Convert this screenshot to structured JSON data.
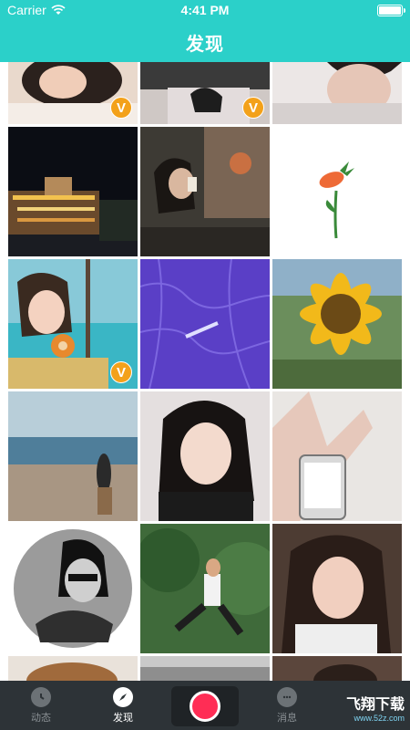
{
  "status_bar": {
    "carrier": "Carrier",
    "time": "4:41 PM"
  },
  "header": {
    "title": "发现"
  },
  "grid": {
    "badge_label": "V",
    "tiles": [
      {
        "name": "photo-girl-lying",
        "badge": true
      },
      {
        "name": "photo-hands-table",
        "badge": true
      },
      {
        "name": "photo-short-hair-girl",
        "badge": false
      },
      {
        "name": "photo-night-building",
        "badge": false
      },
      {
        "name": "photo-boy-drinking",
        "badge": false
      },
      {
        "name": "photo-carrot-flower-drawing",
        "badge": false
      },
      {
        "name": "photo-girl-donut-beach",
        "badge": true
      },
      {
        "name": "photo-purple-illustration",
        "badge": false
      },
      {
        "name": "photo-sunflower",
        "badge": false
      },
      {
        "name": "photo-beach-girl",
        "badge": false
      },
      {
        "name": "photo-girl-portrait",
        "badge": false
      },
      {
        "name": "photo-hand-phone",
        "badge": false
      },
      {
        "name": "photo-man-glasses-bw",
        "badge": false
      },
      {
        "name": "photo-jumping-man-trees",
        "badge": false
      },
      {
        "name": "photo-girl-smiling",
        "badge": false
      }
    ]
  },
  "tabbar": {
    "tabs": [
      {
        "label": "动态",
        "icon": "clock-icon",
        "active": false
      },
      {
        "label": "发现",
        "icon": "compass-icon",
        "active": true
      },
      {
        "label": "消息",
        "icon": "chat-bubble-icon",
        "active": false
      }
    ],
    "record_icon": "record-icon"
  },
  "watermark": {
    "main": "飞翔下载",
    "sub": "www.52z.com"
  },
  "colors": {
    "accent": "#2bd0c9",
    "tabbar_bg": "#2d3337",
    "badge": "#f3a11a",
    "record": "#ff2d55"
  }
}
